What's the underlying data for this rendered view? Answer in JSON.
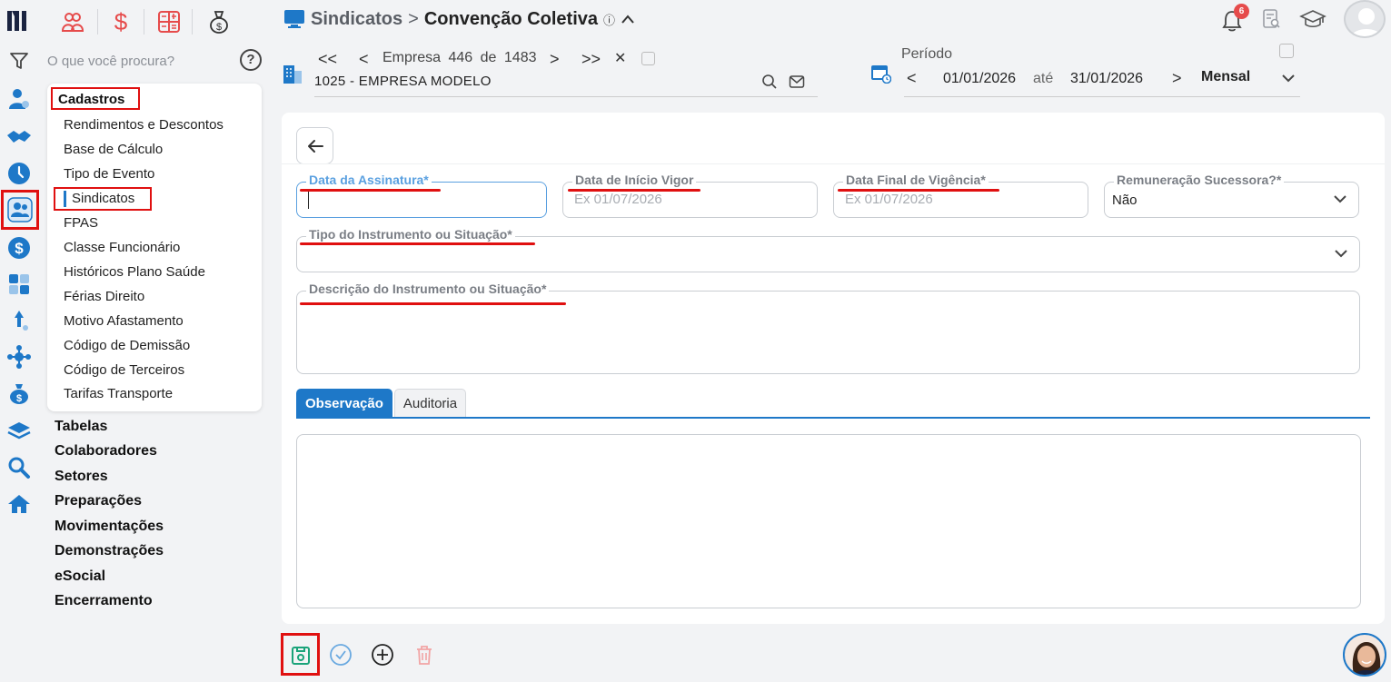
{
  "app": {
    "logo_icon": "app-logo-icon"
  },
  "top_modules": [
    {
      "name": "people-module-icon"
    },
    {
      "name": "dollar-module-icon"
    },
    {
      "name": "calculator-module-icon"
    },
    {
      "name": "money-bag-module-icon"
    }
  ],
  "rail_icons": [
    "filter-icon",
    "user-settings-icon",
    "handshake-icon",
    "clock-icon",
    "people-icon",
    "dollar-circle-icon",
    "calculator-icon",
    "rocket-icon",
    "network-icon",
    "money-bag-icon",
    "layers-icon",
    "search-icon",
    "home-icon"
  ],
  "search": {
    "placeholder": "O que você procura?",
    "help_label": "?"
  },
  "sidebar": {
    "section_title": "Cadastros",
    "sub_items": [
      "Rendimentos e Descontos",
      "Base de Cálculo",
      "Tipo de Evento",
      "Sindicatos",
      "FPAS",
      "Classe Funcionário",
      "Históricos Plano Saúde",
      "Férias Direito",
      "Motivo Afastamento",
      "Código de Demissão",
      "Código de Terceiros",
      "Tarifas Transporte"
    ],
    "main_items": [
      "Tabelas",
      "Colaboradores",
      "Setores",
      "Preparações",
      "Movimentações",
      "Demonstrações",
      "eSocial",
      "Encerramento"
    ]
  },
  "header": {
    "breadcrumb_1": "Sindicatos",
    "separator": ">",
    "breadcrumb_2": "Convenção Coletiva",
    "info_glyph": "ⓘ",
    "notifications_count": "6"
  },
  "company": {
    "first": "<<",
    "prev": "<",
    "label": "Empresa",
    "current": "446",
    "of": "de",
    "total": "1483",
    "next": ">",
    "last": ">>",
    "clear": "✕",
    "name": "1025 - EMPRESA MODELO"
  },
  "period": {
    "label": "Período",
    "prev": "<",
    "start": "01/01/2026",
    "until": "até",
    "end": "31/01/2026",
    "next": ">",
    "mode": "Mensal"
  },
  "form": {
    "data_assinatura": {
      "label": "Data da Assinatura*",
      "value": "",
      "placeholder": ""
    },
    "data_inicio": {
      "label": "Data de Início Vigor",
      "placeholder": "Ex 01/07/2026"
    },
    "data_final": {
      "label": "Data Final de Vigência*",
      "placeholder": "Ex 01/07/2026"
    },
    "remuneracao": {
      "label": "Remuneração Sucessora?*",
      "value": "Não"
    },
    "tipo_instrumento": {
      "label": "Tipo do Instrumento ou Situação*",
      "value": ""
    },
    "descricao": {
      "label": "Descrição do Instrumento ou Situação*",
      "value": ""
    }
  },
  "tabs": [
    {
      "label": "Observação",
      "active": true
    },
    {
      "label": "Auditoria",
      "active": false
    }
  ],
  "observacao": {
    "value": ""
  },
  "colors": {
    "accent": "#1e78c8",
    "highlight_red": "#e01010",
    "save_green": "#1aa37a"
  }
}
